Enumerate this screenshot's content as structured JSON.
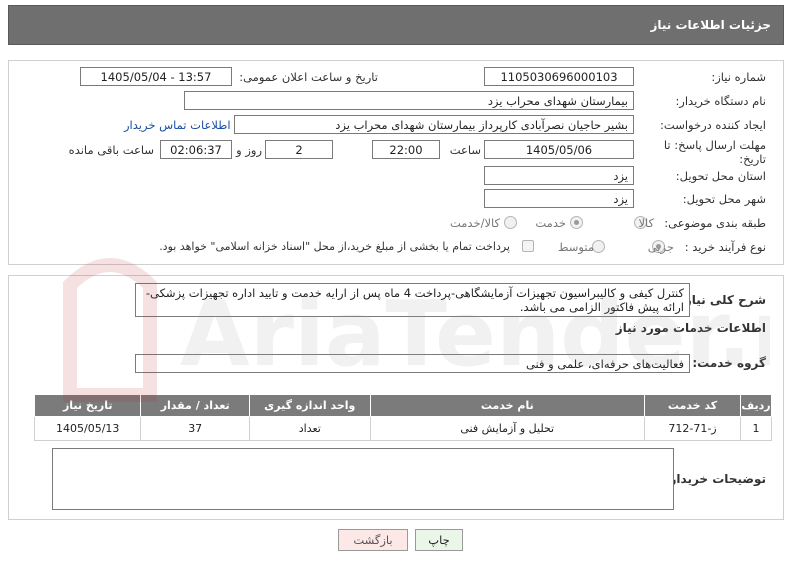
{
  "header": {
    "title": "جزئیات اطلاعات نیاز"
  },
  "form": {
    "need_number_label": "شماره نیاز:",
    "need_number": "1105030696000103",
    "announce_label": "تاریخ و ساعت اعلان عمومی:",
    "announce_value": "1405/05/04 - 13:57",
    "buyer_org_label": "نام دستگاه خریدار:",
    "buyer_org": "بیمارستان شهدای محراب یزد",
    "requester_label": "ایجاد کننده درخواست:",
    "requester": "بشیر حاجیان نصرآبادی کارپرداز بیمارستان شهدای محراب یزد",
    "contact_link": "اطلاعات تماس خریدار",
    "deadline_label_1": "مهلت ارسال پاسخ: تا",
    "deadline_label_2": "تاریخ:",
    "deadline_date": "1405/05/06",
    "time_label": "ساعت",
    "deadline_time": "22:00",
    "days_value": "2",
    "days_label": "روز و",
    "remaining_time": "02:06:37",
    "remaining_label": "ساعت باقی مانده",
    "province_label": "استان محل تحویل:",
    "province": "یزد",
    "city_label": "شهر محل تحویل:",
    "city": "یزد",
    "category_label": "طبقه بندی موضوعی:",
    "category_options": [
      "کالا",
      "خدمت",
      "کالا/خدمت"
    ],
    "process_label": "نوع فرآیند خرید :",
    "process_options": [
      "جزیی",
      "متوسط"
    ],
    "payment_note": "پرداخت تمام یا بخشی از مبلغ خرید،از محل \"اسناد خزانه اسلامی\" خواهد بود."
  },
  "description": {
    "label": "شرح کلی نیاز:",
    "text": "کنترل کیفی و کالیبراسیون تجهیزات آزمایشگاهی-پرداخت 4 ماه پس از ارایه خدمت و تایید اداره تجهیزات پزشکی-ارائه پیش فاکتور الزامی می باشد."
  },
  "services": {
    "section_title": "اطلاعات خدمات مورد نیاز",
    "group_label": "گروه خدمت:",
    "group_value": "فعالیت‌های حرفه‌ای، علمی و فنی",
    "columns": [
      "ردیف",
      "کد خدمت",
      "نام خدمت",
      "واحد اندازه گیری",
      "تعداد / مقدار",
      "تاریخ نیاز"
    ],
    "rows": [
      {
        "row": "1",
        "code": "ز-71-712",
        "name": "تحلیل و آزمایش فنی",
        "unit": "تعداد",
        "qty": "37",
        "date": "1405/05/13"
      }
    ]
  },
  "buyer_notes": {
    "label": "توضیحات خریدار:",
    "value": ""
  },
  "buttons": {
    "print": "چاپ",
    "back": "بازگشت"
  },
  "watermark": {
    "text": "AriaTender.neT"
  },
  "colors": {
    "header_bg": "#6f6f6f",
    "table_header_bg": "#7b7b7b",
    "link": "#1a4fa3",
    "back_button_bg": "#fde8e8",
    "print_button_bg": "#eaf7e8"
  }
}
